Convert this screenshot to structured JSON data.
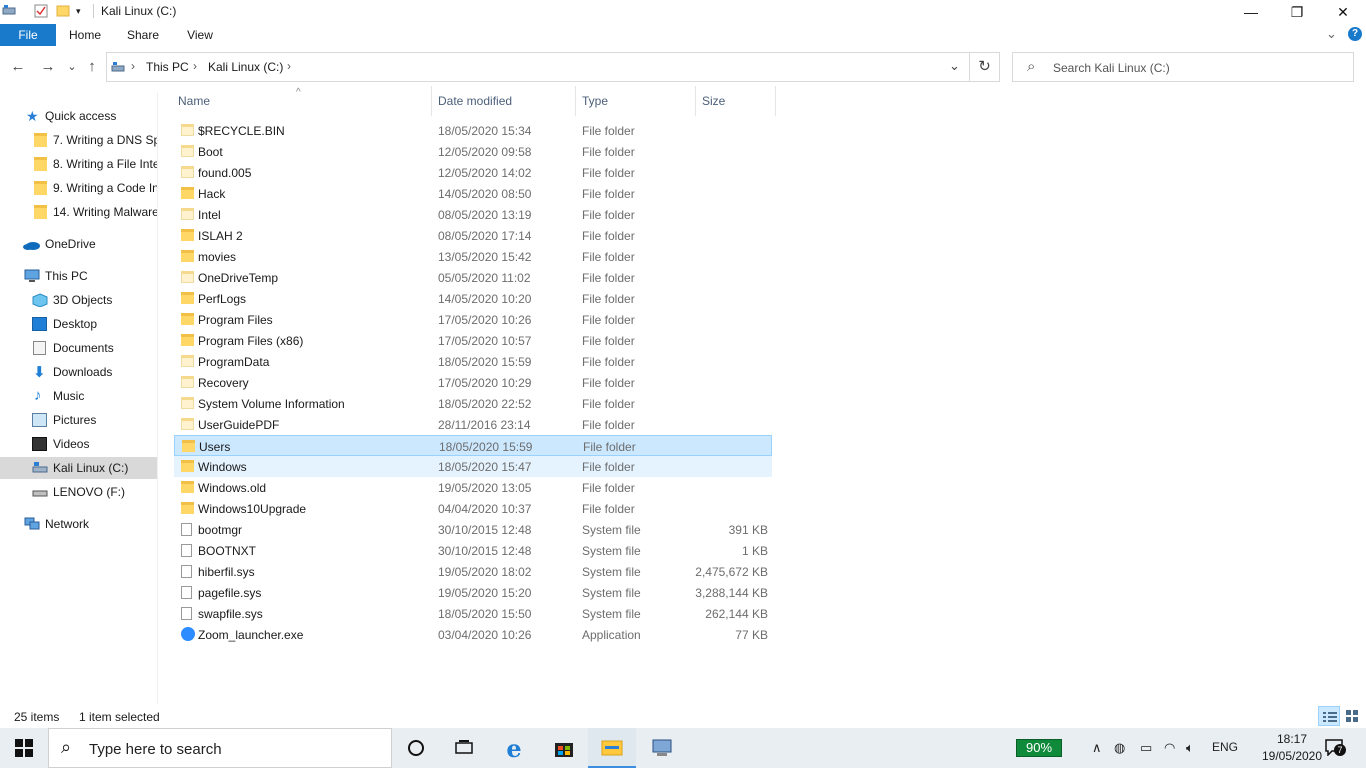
{
  "window": {
    "title": "Kali Linux (C:)",
    "minimize_icon": "—",
    "maximize_icon": "❐",
    "close_icon": "✕"
  },
  "ribbon": {
    "tabs": [
      "File",
      "Home",
      "Share",
      "View"
    ],
    "expand_icon": "⌄",
    "help_icon": "?"
  },
  "nav": {
    "back_icon": "←",
    "forward_icon": "→",
    "recent_icon": "⌄",
    "up_icon": "↑",
    "breadcrumb": [
      "This PC",
      "Kali Linux (C:)"
    ],
    "separator": "›",
    "dropdown_icon": "⌄",
    "refresh_icon": "↻",
    "search_placeholder": "Search Kali Linux (C:)",
    "search_icon": "⌕"
  },
  "sidebar": {
    "quick_access": "Quick access",
    "pinned": [
      "7. Writing a DNS Sp",
      "8. Writing a File Inte",
      "9. Writing a Code In",
      "14. Writing Malware"
    ],
    "onedrive": "OneDrive",
    "this_pc": "This PC",
    "pc_items": [
      "3D Objects",
      "Desktop",
      "Documents",
      "Downloads",
      "Music",
      "Pictures",
      "Videos",
      "Kali Linux (C:)",
      "LENOVO (F:)"
    ],
    "network": "Network"
  },
  "columns": {
    "name": "Name",
    "date": "Date modified",
    "type": "Type",
    "size": "Size",
    "sort_icon": "^"
  },
  "files": [
    {
      "name": "$RECYCLE.BIN",
      "date": "18/05/2020 15:34",
      "type": "File folder",
      "size": "",
      "icon": "folder-light"
    },
    {
      "name": "Boot",
      "date": "12/05/2020 09:58",
      "type": "File folder",
      "size": "",
      "icon": "folder-light"
    },
    {
      "name": "found.005",
      "date": "12/05/2020 14:02",
      "type": "File folder",
      "size": "",
      "icon": "folder-light"
    },
    {
      "name": "Hack",
      "date": "14/05/2020 08:50",
      "type": "File folder",
      "size": "",
      "icon": "folder"
    },
    {
      "name": "Intel",
      "date": "08/05/2020 13:19",
      "type": "File folder",
      "size": "",
      "icon": "folder-light"
    },
    {
      "name": "ISLAH 2",
      "date": "08/05/2020 17:14",
      "type": "File folder",
      "size": "",
      "icon": "folder"
    },
    {
      "name": "movies",
      "date": "13/05/2020 15:42",
      "type": "File folder",
      "size": "",
      "icon": "folder"
    },
    {
      "name": "OneDriveTemp",
      "date": "05/05/2020 11:02",
      "type": "File folder",
      "size": "",
      "icon": "folder-light"
    },
    {
      "name": "PerfLogs",
      "date": "14/05/2020 10:20",
      "type": "File folder",
      "size": "",
      "icon": "folder"
    },
    {
      "name": "Program Files",
      "date": "17/05/2020 10:26",
      "type": "File folder",
      "size": "",
      "icon": "folder"
    },
    {
      "name": "Program Files (x86)",
      "date": "17/05/2020 10:57",
      "type": "File folder",
      "size": "",
      "icon": "folder"
    },
    {
      "name": "ProgramData",
      "date": "18/05/2020 15:59",
      "type": "File folder",
      "size": "",
      "icon": "folder-light"
    },
    {
      "name": "Recovery",
      "date": "17/05/2020 10:29",
      "type": "File folder",
      "size": "",
      "icon": "folder-light"
    },
    {
      "name": "System Volume Information",
      "date": "18/05/2020 22:52",
      "type": "File folder",
      "size": "",
      "icon": "folder-light"
    },
    {
      "name": "UserGuidePDF",
      "date": "28/11/2016 23:14",
      "type": "File folder",
      "size": "",
      "icon": "folder-light"
    },
    {
      "name": "Users",
      "date": "18/05/2020 15:59",
      "type": "File folder",
      "size": "",
      "icon": "folder"
    },
    {
      "name": "Windows",
      "date": "18/05/2020 15:47",
      "type": "File folder",
      "size": "",
      "icon": "folder"
    },
    {
      "name": "Windows.old",
      "date": "19/05/2020 13:05",
      "type": "File folder",
      "size": "",
      "icon": "folder"
    },
    {
      "name": "Windows10Upgrade",
      "date": "04/04/2020 10:37",
      "type": "File folder",
      "size": "",
      "icon": "folder"
    },
    {
      "name": "bootmgr",
      "date": "30/10/2015 12:48",
      "type": "System file",
      "size": "391 KB",
      "icon": "sysfile"
    },
    {
      "name": "BOOTNXT",
      "date": "30/10/2015 12:48",
      "type": "System file",
      "size": "1 KB",
      "icon": "sysfile"
    },
    {
      "name": "hiberfil.sys",
      "date": "19/05/2020 18:02",
      "type": "System file",
      "size": "2,475,672 KB",
      "icon": "sysfile"
    },
    {
      "name": "pagefile.sys",
      "date": "19/05/2020 15:20",
      "type": "System file",
      "size": "3,288,144 KB",
      "icon": "sysfile"
    },
    {
      "name": "swapfile.sys",
      "date": "18/05/2020 15:50",
      "type": "System file",
      "size": "262,144 KB",
      "icon": "sysfile"
    },
    {
      "name": "Zoom_launcher.exe",
      "date": "03/04/2020 10:26",
      "type": "Application",
      "size": "77 KB",
      "icon": "zoom"
    }
  ],
  "selected_index": 15,
  "hover_index": 16,
  "status": {
    "items": "25 items",
    "selected": "1 item selected"
  },
  "taskbar": {
    "search_placeholder": "Type here to search",
    "battery": "90%",
    "language": "ENG",
    "time": "18:17",
    "date": "19/05/2020",
    "notification_count": "7"
  },
  "colors": {
    "accent": "#1979ca",
    "selected_bg": "#cce8ff",
    "folder": "#ffd766"
  }
}
